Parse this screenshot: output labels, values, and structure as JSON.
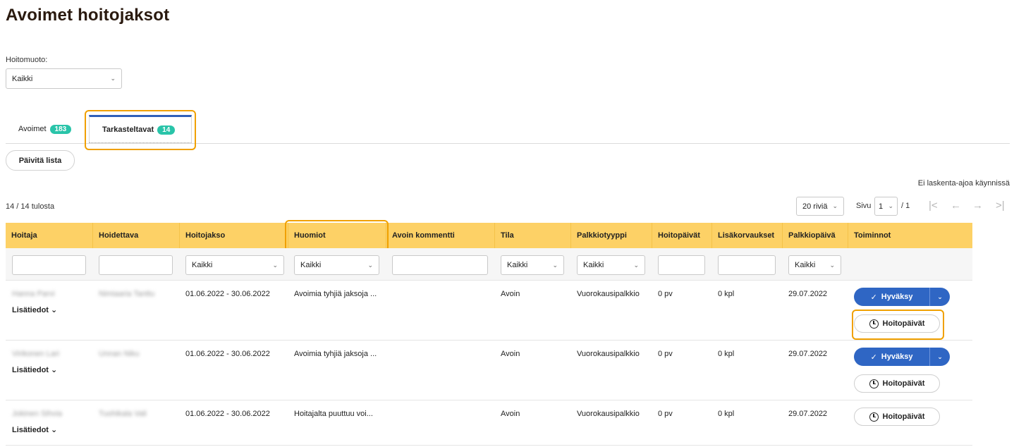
{
  "page": {
    "title": "Avoimet hoitojaksot"
  },
  "filter": {
    "label": "Hoitomuoto:",
    "value": "Kaikki"
  },
  "tabs": [
    {
      "label": "Avoimet",
      "count": "183"
    },
    {
      "label": "Tarkasteltavat",
      "count": "14"
    }
  ],
  "refresh_label": "Päivitä lista",
  "status_text": "Ei laskenta-ajoa käynnissä",
  "results_text": "14 / 14 tulosta",
  "pagination": {
    "rows": "20 riviä",
    "page_label": "Sivu",
    "page": "1",
    "of": "/ 1"
  },
  "columns": [
    "Hoitaja",
    "Hoidettava",
    "Hoitojakso",
    "Huomiot",
    "Avoin kommentti",
    "Tila",
    "Palkkiotyyppi",
    "Hoitopäivät",
    "Lisäkorvaukset",
    "Palkkiopäivä",
    "Toiminnot"
  ],
  "filters": {
    "all": "Kaikki"
  },
  "actions": {
    "approve": "Hyväksy",
    "days": "Hoitopäivät",
    "details": "Lisätiedot"
  },
  "rows": [
    {
      "hoitaja": "Hanna Parvi",
      "hoidettava": "Nimiaaria Tanttu",
      "jakso": "01.06.2022 - 30.06.2022",
      "huomiot": "Avoimia tyhjiä jaksoja ...",
      "kommentti": "",
      "tila": "Avoin",
      "tyyppi": "Vuorokausipalkkio",
      "paivat": "0 pv",
      "lisa": "0 kpl",
      "pvm": "29.07.2022"
    },
    {
      "hoitaja": "Virikonen Lari",
      "hoidettava": "Unnan Niku",
      "jakso": "01.06.2022 - 30.06.2022",
      "huomiot": "Avoimia tyhjiä jaksoja ...",
      "kommentti": "",
      "tila": "Avoin",
      "tyyppi": "Vuorokausipalkkio",
      "paivat": "0 pv",
      "lisa": "0 kpl",
      "pvm": "29.07.2022"
    },
    {
      "hoitaja": "Jokinen Sihvia",
      "hoidettava": "Tuohikala Vali",
      "jakso": "01.06.2022 - 30.06.2022",
      "huomiot": "Hoitajalta puuttuu voi...",
      "kommentti": "",
      "tila": "Avoin",
      "tyyppi": "Vuorokausipalkkio",
      "paivat": "0 pv",
      "lisa": "0 kpl",
      "pvm": "29.07.2022"
    }
  ]
}
